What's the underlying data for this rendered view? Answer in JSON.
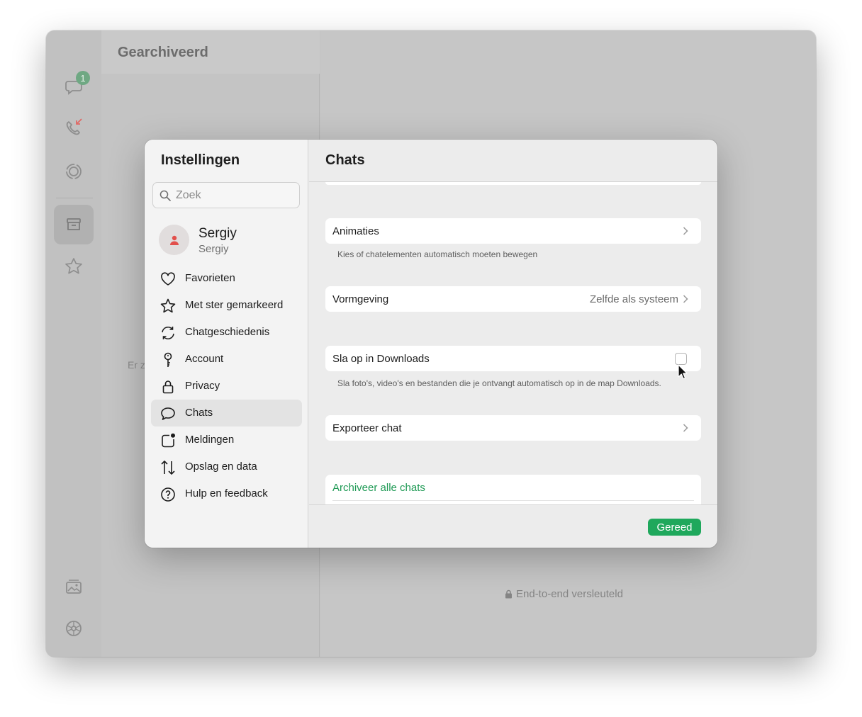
{
  "window": {
    "list_title": "Gearchiveerd",
    "empty_text": "Er z",
    "encrypted_label": "End-to-end versleuteld",
    "unread_badge": "1"
  },
  "rail": {
    "icons": [
      "chats-icon",
      "calls-icon",
      "status-icon",
      "archive-icon",
      "starred-icon",
      "media-icon",
      "settings-icon"
    ]
  },
  "settings": {
    "title": "Instellingen",
    "search_placeholder": "Zoek",
    "profile": {
      "name": "Sergiy",
      "subtitle": "Sergiy"
    },
    "nav": [
      {
        "label": "Favorieten",
        "icon": "heart-icon"
      },
      {
        "label": "Met ster gemarkeerd",
        "icon": "star-icon"
      },
      {
        "label": "Chatgeschiedenis",
        "icon": "sync-icon"
      },
      {
        "label": "Account",
        "icon": "key-icon"
      },
      {
        "label": "Privacy",
        "icon": "lock-icon"
      },
      {
        "label": "Chats",
        "icon": "chat-bubble-icon",
        "active": true
      },
      {
        "label": "Meldingen",
        "icon": "notification-icon"
      },
      {
        "label": "Opslag en data",
        "icon": "up-down-arrows-icon"
      },
      {
        "label": "Hulp en feedback",
        "icon": "help-icon"
      }
    ]
  },
  "chats": {
    "title": "Chats",
    "animations_label": "Animaties",
    "animations_hint": "Kies of chatelementen automatisch moeten bewegen",
    "appearance_label": "Vormgeving",
    "appearance_value": "Zelfde als systeem",
    "save_downloads_label": "Sla op in Downloads",
    "save_downloads_checked": false,
    "save_downloads_hint": "Sla foto's, video's en bestanden die je ontvangt automatisch op in de map Downloads.",
    "export_label": "Exporteer chat",
    "archive_all_label": "Archiveer alle chats",
    "done_label": "Gereed"
  },
  "colors": {
    "accent_green": "#1fa85c",
    "badge_green": "#6fa883",
    "missed_call_red": "#e06a66"
  }
}
